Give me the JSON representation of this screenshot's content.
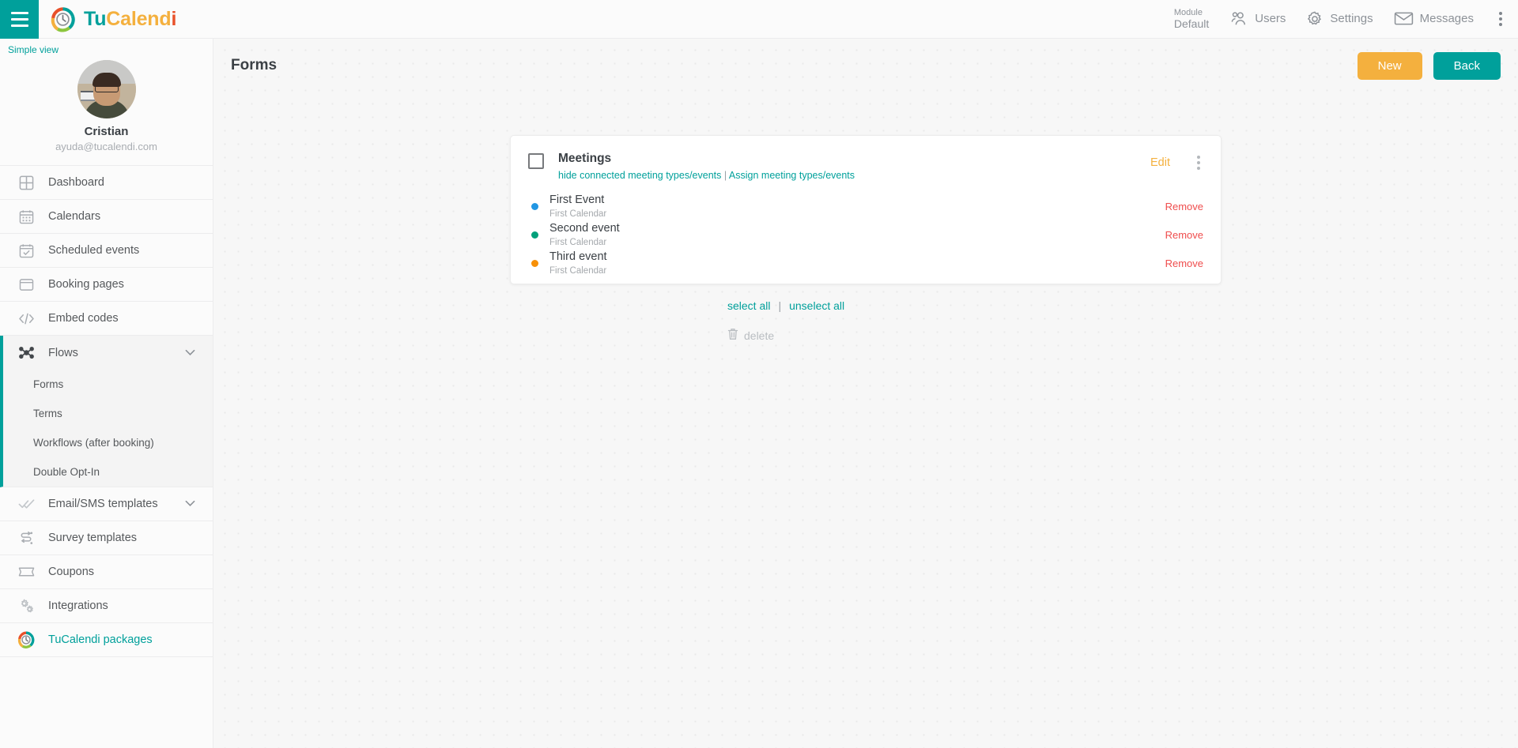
{
  "topbar": {
    "menu_icon": "hamburger-icon",
    "brand": {
      "part1": "Tu",
      "part2": "Calend",
      "part3": "i",
      "logo_icon": "tucalendi-logo-icon"
    },
    "module": {
      "label": "Module",
      "value": "Default"
    },
    "items": [
      {
        "label": "Users",
        "icon": "users-icon"
      },
      {
        "label": "Settings",
        "icon": "gear-icon"
      },
      {
        "label": "Messages",
        "icon": "envelope-icon"
      }
    ],
    "overflow_icon": "kebab-menu-icon"
  },
  "sidebar": {
    "simple_view": "Simple view",
    "profile": {
      "name": "Cristian",
      "email": "ayuda@tucalendi.com",
      "avatar": "user-avatar-photo"
    },
    "items": [
      {
        "label": "Dashboard",
        "icon": "dashboard-grid-icon"
      },
      {
        "label": "Calendars",
        "icon": "calendar-icon"
      },
      {
        "label": "Scheduled events",
        "icon": "calendar-check-icon"
      },
      {
        "label": "Booking pages",
        "icon": "window-icon"
      },
      {
        "label": "Embed codes",
        "icon": "code-brackets-icon"
      }
    ],
    "flows": {
      "label": "Flows",
      "icon": "flows-node-icon",
      "chevron": "chevron-down-icon",
      "sub_items": [
        {
          "label": "Forms"
        },
        {
          "label": "Terms"
        },
        {
          "label": "Workflows (after booking)"
        },
        {
          "label": "Double Opt-In"
        }
      ]
    },
    "items_after": [
      {
        "label": "Email/SMS templates",
        "icon": "double-check-icon",
        "chevron": "chevron-down-icon"
      },
      {
        "label": "Survey templates",
        "icon": "survey-flow-icon"
      },
      {
        "label": "Coupons",
        "icon": "ticket-icon"
      },
      {
        "label": "Integrations",
        "icon": "gears-icon"
      },
      {
        "label": "TuCalendi packages",
        "icon": "tucalendi-logo-icon",
        "accent": true
      }
    ]
  },
  "main": {
    "page_title": "Forms",
    "buttons": {
      "new": "New",
      "back": "Back"
    },
    "form_card": {
      "title": "Meetings",
      "link_hide": "hide connected meeting types/events",
      "link_separator": "|",
      "link_assign": "Assign meeting types/events",
      "edit_label": "Edit",
      "checkbox_icon": "checkbox-unchecked-icon",
      "kebab_icon": "kebab-menu-icon",
      "events": [
        {
          "name": "First Event",
          "calendar": "First Calendar",
          "dot_color": "#2196e3",
          "remove_label": "Remove"
        },
        {
          "name": "Second event",
          "calendar": "First Calendar",
          "dot_color": "#00a07a",
          "remove_label": "Remove"
        },
        {
          "name": "Third event",
          "calendar": "First Calendar",
          "dot_color": "#f79007",
          "remove_label": "Remove"
        }
      ]
    },
    "bulk": {
      "select_all": "select all",
      "separator": "|",
      "unselect_all": "unselect all"
    },
    "delete": {
      "label": "delete",
      "icon": "trash-icon"
    }
  },
  "colors": {
    "teal": "#00a09b",
    "amber": "#f4b03e",
    "red": "#ef4d4d",
    "orange": "#e8502a"
  }
}
